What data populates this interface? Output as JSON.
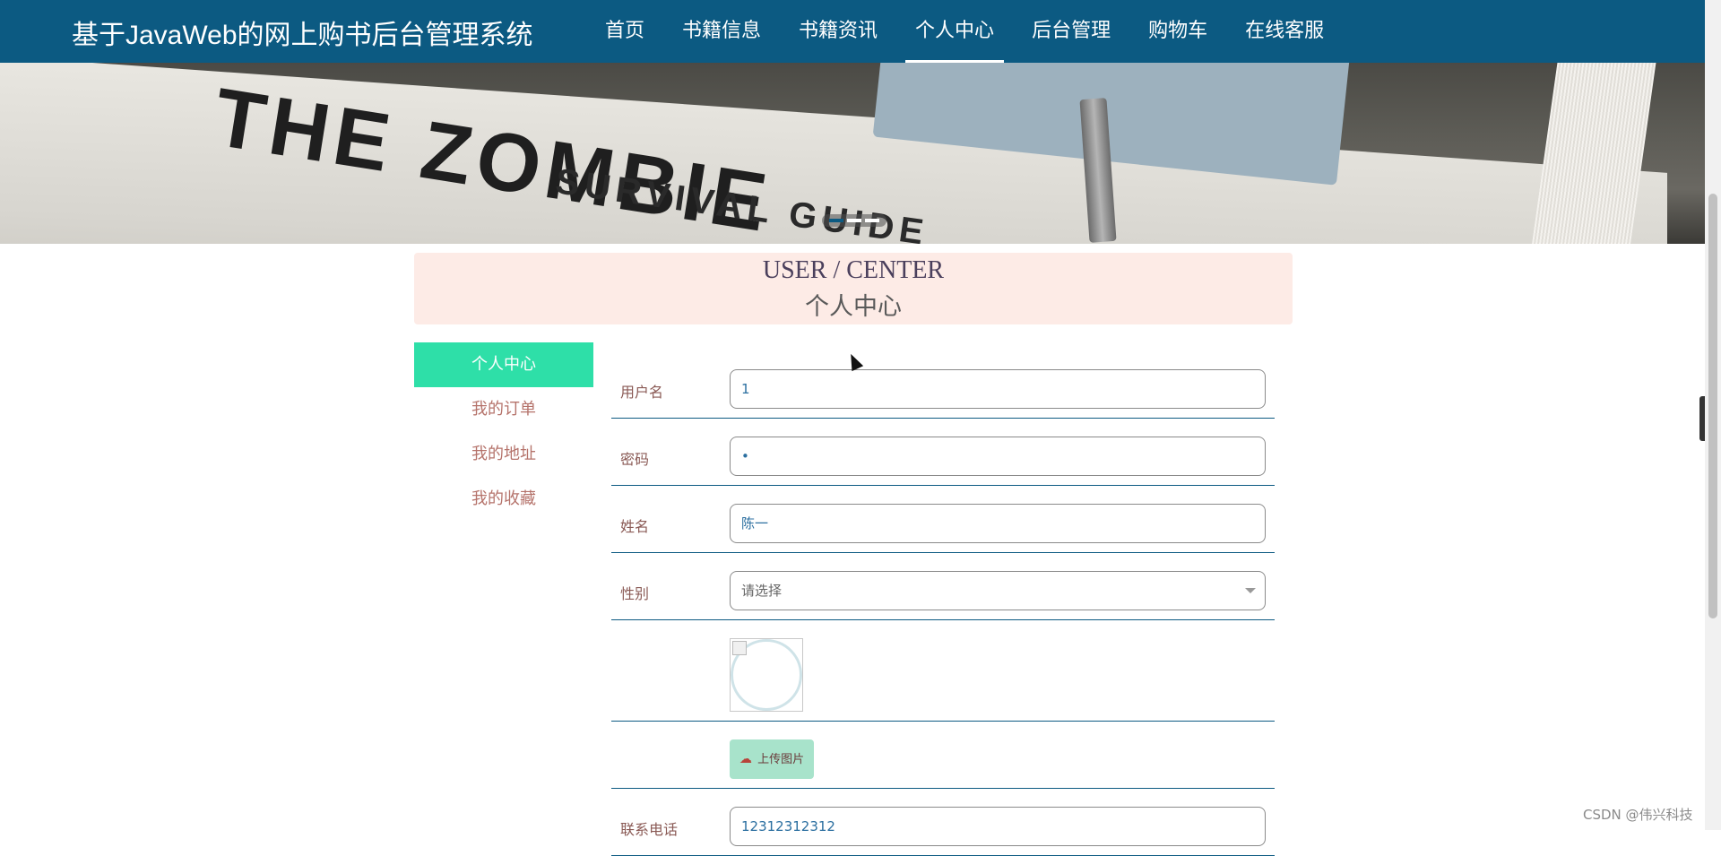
{
  "header": {
    "brand": "基于JavaWeb的网上购书后台管理系统",
    "nav": [
      "首页",
      "书籍信息",
      "书籍资讯",
      "个人中心",
      "后台管理",
      "购物车",
      "在线客服"
    ],
    "active_nav": "个人中心"
  },
  "banner": {
    "image_text_1": "THE ZOMBIE",
    "image_text_2": "SURVIVAL GUIDE",
    "slides": 3,
    "active_slide": 1
  },
  "section_title": {
    "en": "USER / CENTER",
    "cn": "个人中心"
  },
  "sidebar": {
    "items": [
      "个人中心",
      "我的订单",
      "我的地址",
      "我的收藏"
    ],
    "active": "个人中心"
  },
  "form": {
    "username_label": "用户名",
    "username_value": "1",
    "password_label": "密码",
    "password_value": "•",
    "name_label": "姓名",
    "name_value": "陈一",
    "gender_label": "性别",
    "gender_placeholder": "请选择",
    "upload_label": "上传图片",
    "phone_label": "联系电话",
    "phone_value": "12312312312"
  },
  "icons": {
    "upload": "cloud-upload-icon",
    "side_toggle": "chevron-left-icon"
  },
  "watermark": "CSDN @伟兴科技",
  "colors": {
    "nav_bg": "#0c5a82",
    "active_side": "#2edfa8",
    "title_bg": "#fdebe6",
    "upload_bg": "#a8e3cb"
  }
}
